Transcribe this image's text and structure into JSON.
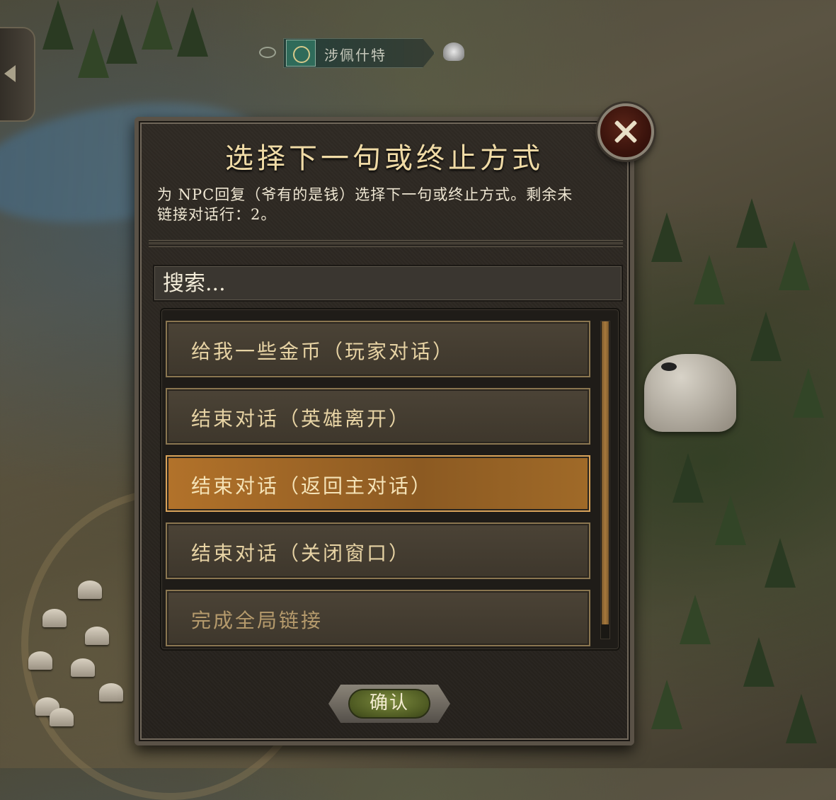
{
  "map": {
    "settlement_name": "涉佩什特"
  },
  "dialog": {
    "title": "选择下一句或终止方式",
    "description": "为 NPC回复（爷有的是钱）选择下一句或终止方式。剩余未链接对话行：2。",
    "search_placeholder": "搜索...",
    "options": [
      {
        "label": "给我一些金币（玩家对话）",
        "selected": false
      },
      {
        "label": "结束对话（英雄离开）",
        "selected": false
      },
      {
        "label": "结束对话（返回主对话）",
        "selected": true
      },
      {
        "label": "结束对话（关闭窗口）",
        "selected": false
      },
      {
        "label": "完成全局链接",
        "selected": false
      }
    ],
    "confirm_label": "确认"
  },
  "colors": {
    "accent_selected": "#b2722a",
    "title_text": "#f0dba6",
    "confirm_green": "#7c8a3e",
    "close_red": "#5a2418"
  },
  "icons": [
    "eye-icon",
    "faction-emblem-icon",
    "helmet-icon",
    "close-icon",
    "back-arrow-icon"
  ]
}
